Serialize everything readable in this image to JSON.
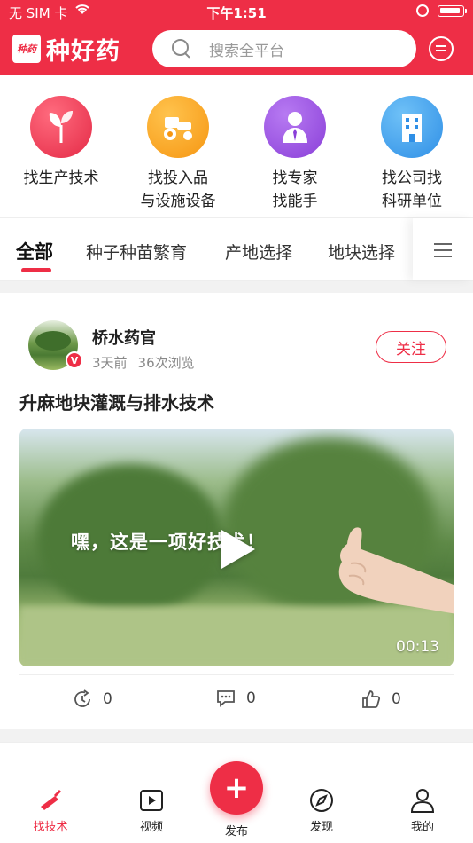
{
  "status_bar": {
    "carrier": "无 SIM 卡",
    "time": "下午1:51"
  },
  "brand": {
    "logo_mark": "种药",
    "name": "种好药",
    "color": "#ee2e46"
  },
  "search": {
    "placeholder": "搜索全平台"
  },
  "categories": [
    {
      "line1": "找生产技术",
      "line2": "",
      "icon": "sprout-icon",
      "color": "#ea3550"
    },
    {
      "line1": "找投入品",
      "line2": "与设施设备",
      "icon": "tractor-icon",
      "color": "#f9a21b"
    },
    {
      "line1": "找专家",
      "line2": "找能手",
      "icon": "expert-icon",
      "color": "#9b4fe0"
    },
    {
      "line1": "找公司找",
      "line2": "科研单位",
      "icon": "building-icon",
      "color": "#3d9be9"
    }
  ],
  "tabs": [
    "全部",
    "种子种苗繁育",
    "产地选择",
    "地块选择"
  ],
  "post": {
    "author": "桥水药官",
    "badge": "V",
    "time_ago": "3天前",
    "views": "36次浏览",
    "follow_label": "关注",
    "title": "升麻地块灌溉与排水技术",
    "video_caption": "嘿，这是一项好技术！",
    "duration": "00:13",
    "shares": "0",
    "comments": "0",
    "likes": "0"
  },
  "tabbar": {
    "items": [
      "找技术",
      "视频",
      "发布",
      "发现",
      "我的"
    ],
    "publish_symbol": "+"
  }
}
